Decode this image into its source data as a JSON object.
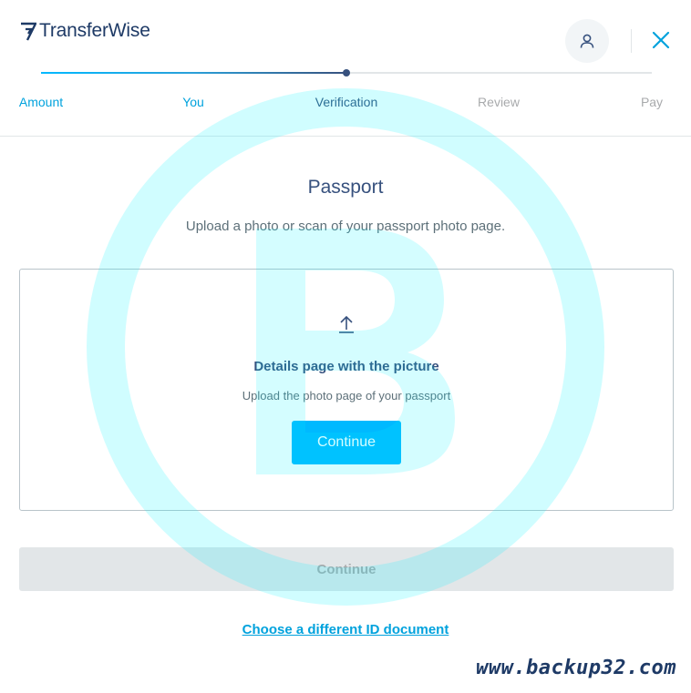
{
  "header": {
    "logo_text": "TransferWise",
    "logo_icon": "transferwise-flag-icon",
    "avatar_icon": "user-icon",
    "close_icon": "close-icon",
    "colors": {
      "brand_blue": "#00b9ff",
      "navy": "#37517e",
      "link_blue": "#00a2dd"
    }
  },
  "stepper": {
    "progress": 0.5,
    "steps": [
      {
        "label": "Amount",
        "state": "done"
      },
      {
        "label": "You",
        "state": "done"
      },
      {
        "label": "Verification",
        "state": "active"
      },
      {
        "label": "Review",
        "state": "todo"
      },
      {
        "label": "Pay",
        "state": "todo"
      }
    ]
  },
  "content": {
    "title": "Passport",
    "subtitle": "Upload a photo or scan of your passport photo page.",
    "upload": {
      "icon": "upload-icon",
      "title": "Details page with the picture",
      "description": "Upload the photo page of your passport",
      "button_label": "Continue"
    },
    "continue_label": "Continue",
    "choose_link": "Choose a different ID document"
  },
  "watermark": {
    "text": "www.backup32.com",
    "logo": "backup32-b-circle-logo",
    "color": "#00f0ff"
  }
}
